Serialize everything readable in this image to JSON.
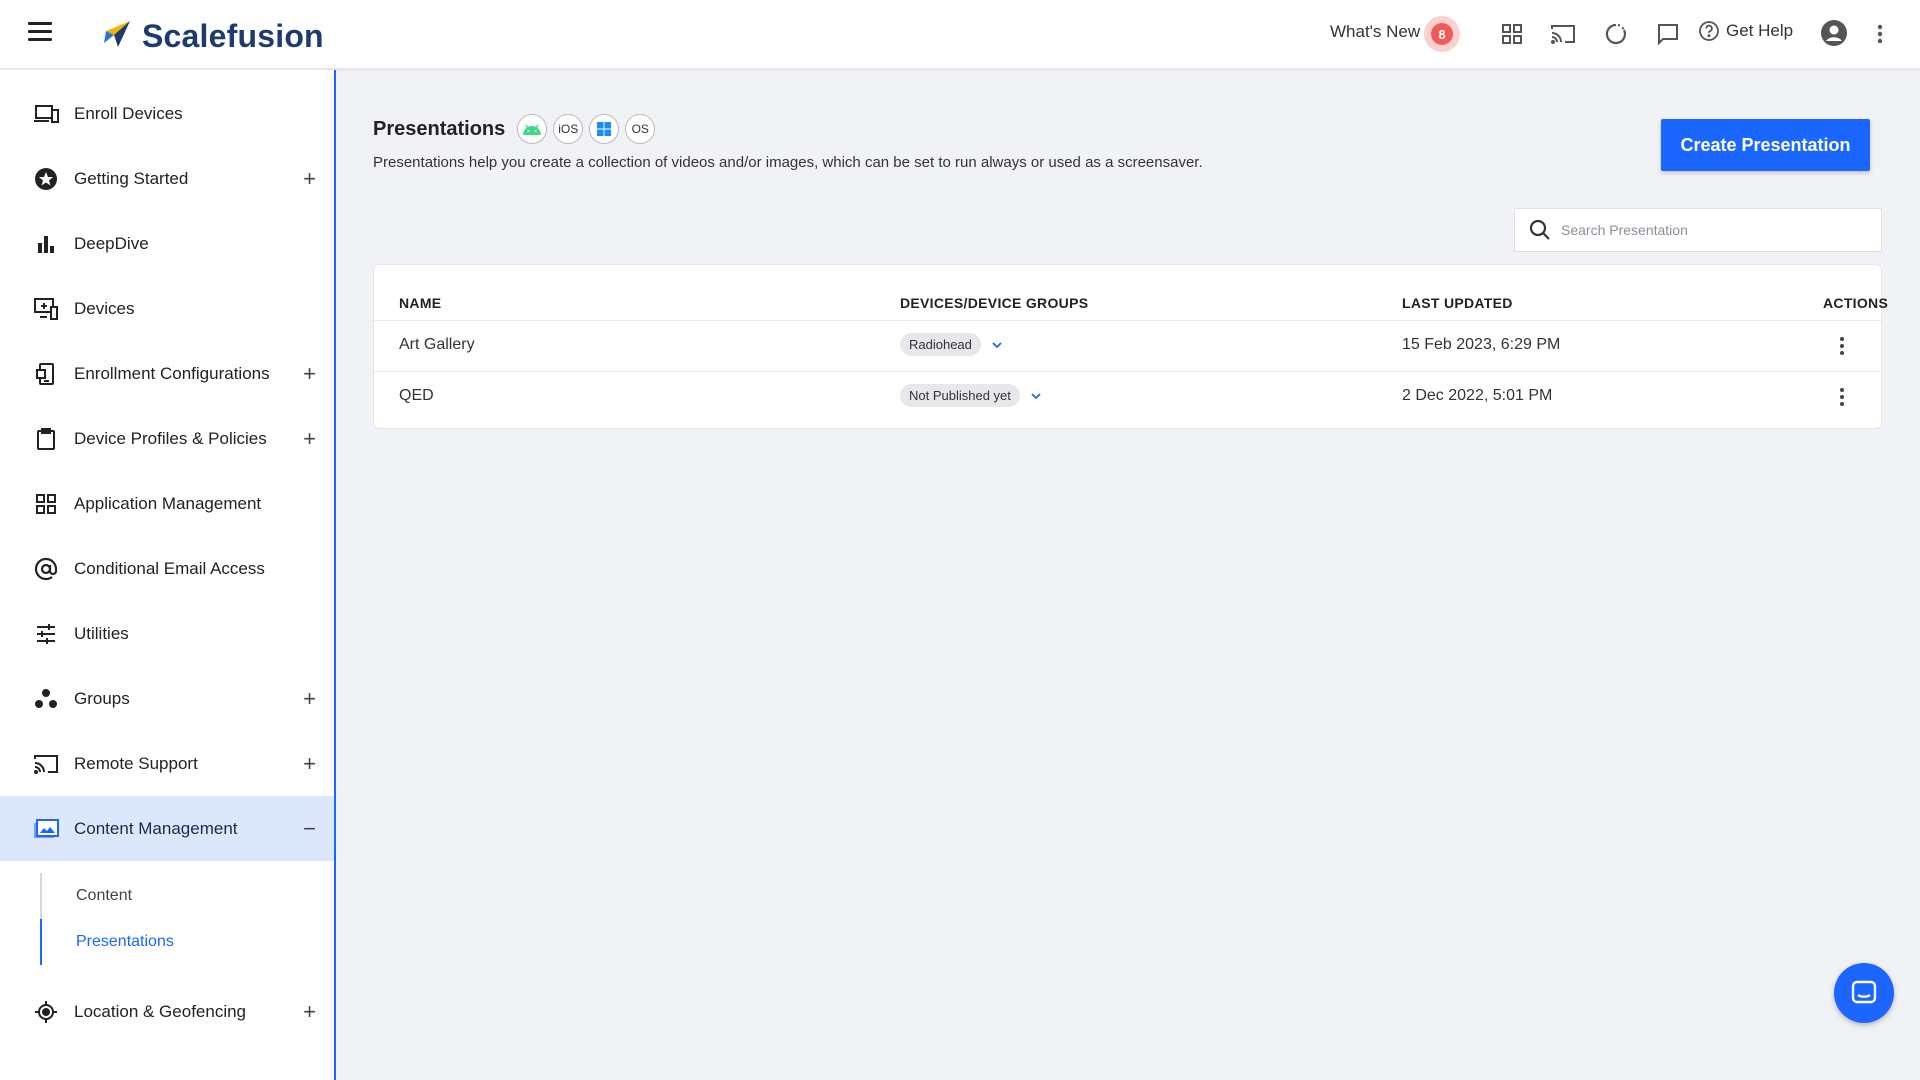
{
  "brand": {
    "name": "Scalefusion",
    "logo_color": "#f5b400",
    "text_color": "#1e3a6e"
  },
  "header": {
    "whats_new_label": "What's New",
    "whats_new_count": "8",
    "icons": [
      "apps-grid-icon",
      "cast-icon",
      "refresh-icon",
      "chat-icon"
    ],
    "get_help_label": "Get Help"
  },
  "sidebar": {
    "items": [
      {
        "label": "Enroll Devices",
        "icon": "enroll-devices-icon",
        "expandable": false
      },
      {
        "label": "Getting Started",
        "icon": "star-badge-icon",
        "expandable": true
      },
      {
        "label": "DeepDive",
        "icon": "bar-chart-icon",
        "expandable": false
      },
      {
        "label": "Devices",
        "icon": "devices-icon",
        "expandable": false
      },
      {
        "label": "Enrollment Configurations",
        "icon": "enrollment-config-icon",
        "expandable": true
      },
      {
        "label": "Device Profiles & Policies",
        "icon": "clipboard-icon",
        "expandable": true
      },
      {
        "label": "Application Management",
        "icon": "grid-icon",
        "expandable": false
      },
      {
        "label": "Conditional Email Access",
        "icon": "at-sign-icon",
        "expandable": false
      },
      {
        "label": "Utilities",
        "icon": "sliders-icon",
        "expandable": false
      },
      {
        "label": "Groups",
        "icon": "groups-icon",
        "expandable": true
      },
      {
        "label": "Remote Support",
        "icon": "cast-icon",
        "expandable": true
      },
      {
        "label": "Content Management",
        "icon": "photo-folder-icon",
        "expandable": true,
        "active": true
      }
    ],
    "sub_items": [
      {
        "label": "Content",
        "active": false
      },
      {
        "label": "Presentations",
        "active": true
      }
    ],
    "after_items": [
      {
        "label": "Location & Geofencing",
        "icon": "location-target-icon",
        "expandable": true
      }
    ],
    "expand_symbol": "+",
    "collapse_symbol": "−"
  },
  "main": {
    "title": "Presentations",
    "os_badges": [
      "android",
      "iOS",
      "windows",
      "OS"
    ],
    "description": "Presentations help you create a collection of videos and/or images, which can be set to run always or used as a screensaver.",
    "create_button": "Create Presentation",
    "search_placeholder": "Search Presentation",
    "table": {
      "headers": [
        "NAME",
        "DEVICES/DEVICE GROUPS",
        "LAST UPDATED",
        "ACTIONS"
      ],
      "rows": [
        {
          "name": "Art Gallery",
          "group": "Radiohead",
          "updated": "15 Feb 2023, 6:29 PM"
        },
        {
          "name": "QED",
          "group": "Not Published yet",
          "updated": "2 Dec 2022, 5:01 PM"
        }
      ]
    }
  },
  "colors": {
    "accent": "#1a66ff",
    "active_bg": "#dce7fb",
    "badge": "#f25a5a"
  }
}
